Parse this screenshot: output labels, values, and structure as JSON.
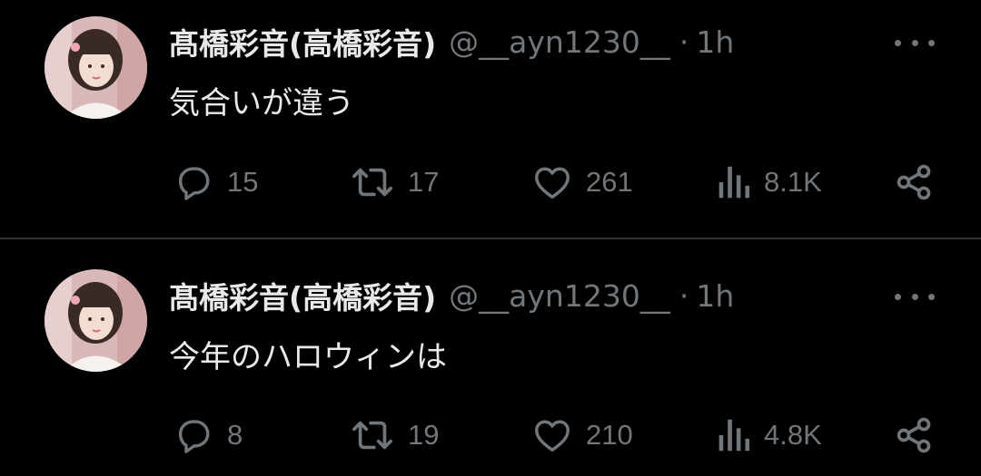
{
  "tweets": [
    {
      "author_name": "髙橋彩音(高橋彩音)",
      "handle": "@__ayn1230__",
      "separator": "·",
      "time": "1h",
      "text": "気合いが違う",
      "reply_count": "15",
      "retweet_count": "17",
      "like_count": "261",
      "view_count": "8.1K"
    },
    {
      "author_name": "髙橋彩音(高橋彩音)",
      "handle": "@__ayn1230__",
      "separator": "·",
      "time": "1h",
      "text": "今年のハロウィンは",
      "reply_count": "8",
      "retweet_count": "19",
      "like_count": "210",
      "view_count": "4.8K"
    }
  ],
  "icons": [
    "more-icon",
    "reply-icon",
    "retweet-icon",
    "like-icon",
    "views-icon",
    "share-icon"
  ],
  "colors": {
    "background": "#000000",
    "primary_text": "#e7e9ea",
    "secondary_text": "#71767b",
    "divider": "#2f3336"
  }
}
